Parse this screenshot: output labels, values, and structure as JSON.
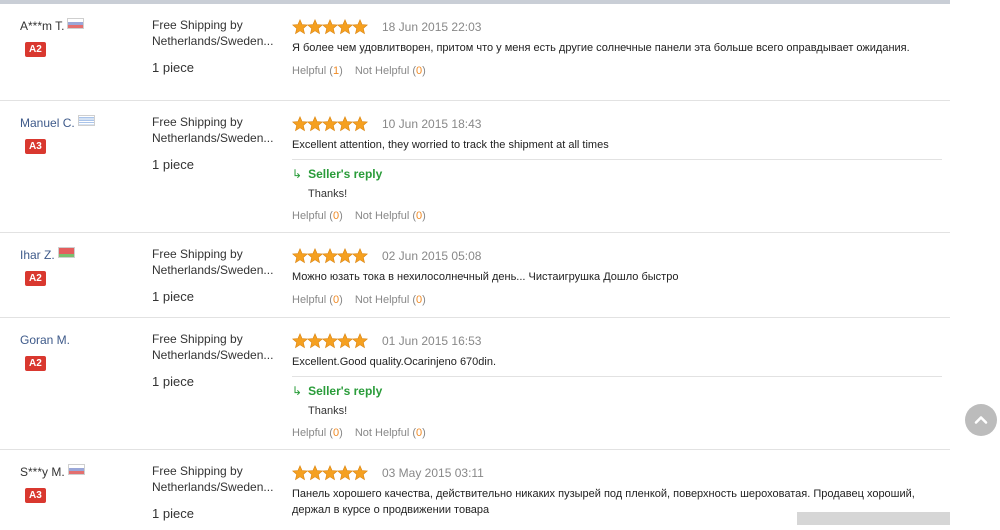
{
  "colors": {
    "star": "#f5a020",
    "badge": "#d9382f",
    "reply": "#2a9c3a",
    "count": "#f08a24"
  },
  "icons": {
    "star": "star-icon",
    "reply": "reply-arrow-icon",
    "scroll_top": "chevron-up-icon"
  },
  "reviews": [
    {
      "user": "A***m T.",
      "flag": "russia-flag-icon",
      "level": "A2",
      "shipping": "Free Shipping by Netherlands/Sweden...",
      "qty": "1 piece",
      "rating": 5,
      "date": "18 Jun 2015 22:03",
      "text": "Я более чем удовлитворен, притом что у меня есть другие солнечные панели эта больше всего оправдывает ожидания.",
      "helpful_label": "Helpful",
      "helpful_count": "1",
      "not_helpful_label": "Not Helpful",
      "not_helpful_count": "0"
    },
    {
      "user": "Manuel C.",
      "flag": "uruguay-flag-icon",
      "level": "A3",
      "shipping": "Free Shipping by Netherlands/Sweden...",
      "qty": "1 piece",
      "rating": 5,
      "date": "10 Jun 2015 18:43",
      "text": "Excellent attention, they worried to track the shipment at all times",
      "reply_label": "Seller's reply",
      "reply_text": "Thanks!",
      "helpful_label": "Helpful",
      "helpful_count": "0",
      "not_helpful_label": "Not Helpful",
      "not_helpful_count": "0"
    },
    {
      "user": "Ihar Z.",
      "flag": "belarus-flag-icon",
      "level": "A2",
      "shipping": "Free Shipping by Netherlands/Sweden...",
      "qty": "1 piece",
      "rating": 5,
      "date": "02 Jun 2015 05:08",
      "text": "Можно юзать тока в нехилосолнечный день... Чистаигрушка Дошло быстро",
      "helpful_label": "Helpful",
      "helpful_count": "0",
      "not_helpful_label": "Not Helpful",
      "not_helpful_count": "0"
    },
    {
      "user": "Goran M.",
      "level": "A2",
      "shipping": "Free Shipping by Netherlands/Sweden...",
      "qty": "1 piece",
      "rating": 5,
      "date": "01 Jun 2015 16:53",
      "text": "Excellent.Good quality.Ocarinjeno 670din.",
      "reply_label": "Seller's reply",
      "reply_text": "Thanks!",
      "helpful_label": "Helpful",
      "helpful_count": "0",
      "not_helpful_label": "Not Helpful",
      "not_helpful_count": "0"
    },
    {
      "user": "S***y M.",
      "flag": "russia-flag-icon",
      "level": "A3",
      "shipping": "Free Shipping by Netherlands/Sweden...",
      "qty": "1 piece",
      "rating": 5,
      "date": "03 May 2015 03:11",
      "text": "Панель хорошего качества, действительно никаких пузырей под пленкой, поверхность шероховатая. Продавец хороший, держал в курсе о продвижении товара"
    }
  ]
}
